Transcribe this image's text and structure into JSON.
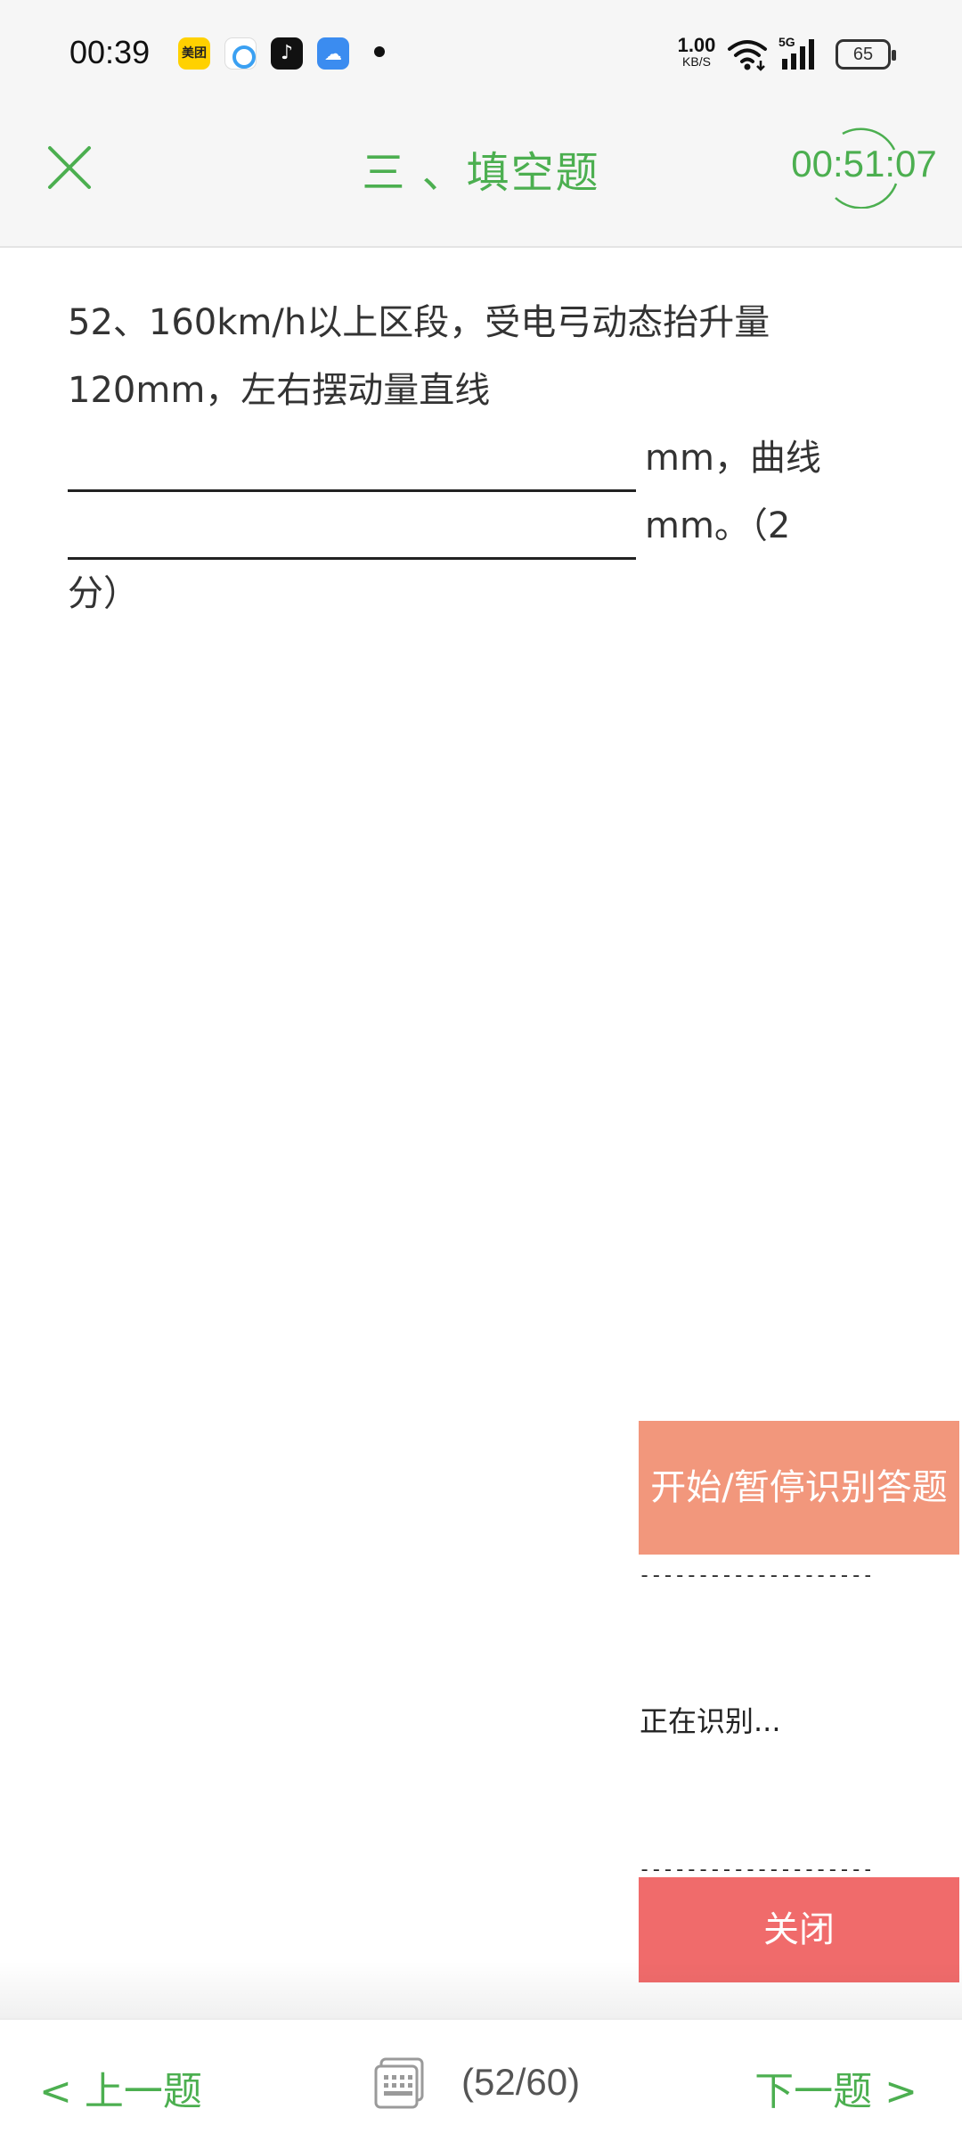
{
  "status_bar": {
    "time": "00:39",
    "meituan_label": "美团",
    "net_speed_value": "1.00",
    "net_speed_unit": "KB/S",
    "network_type": "5G",
    "battery": "65"
  },
  "header": {
    "title": "三 、填空题",
    "timer": "00:51:07"
  },
  "question": {
    "line1": "52、160km/h以上区段，受电弓动态抬升量",
    "line2": "120mm，左右摆动量直线",
    "after_blank1": "mm，曲线",
    "after_blank2": "mm。（2",
    "line5": "分）"
  },
  "recognition_panel": {
    "toggle_label": "开始/暂停识别答题",
    "separator": "-------------------------",
    "status": "正在识别...",
    "close_label": "关闭"
  },
  "bottom_nav": {
    "prev_label": "< 上一题",
    "next_label": "下一题 >",
    "counter": "(52/60)"
  },
  "colors": {
    "accent_green": "#4caf50",
    "recog_orange": "#f2977c",
    "close_red": "#f06b6b"
  }
}
